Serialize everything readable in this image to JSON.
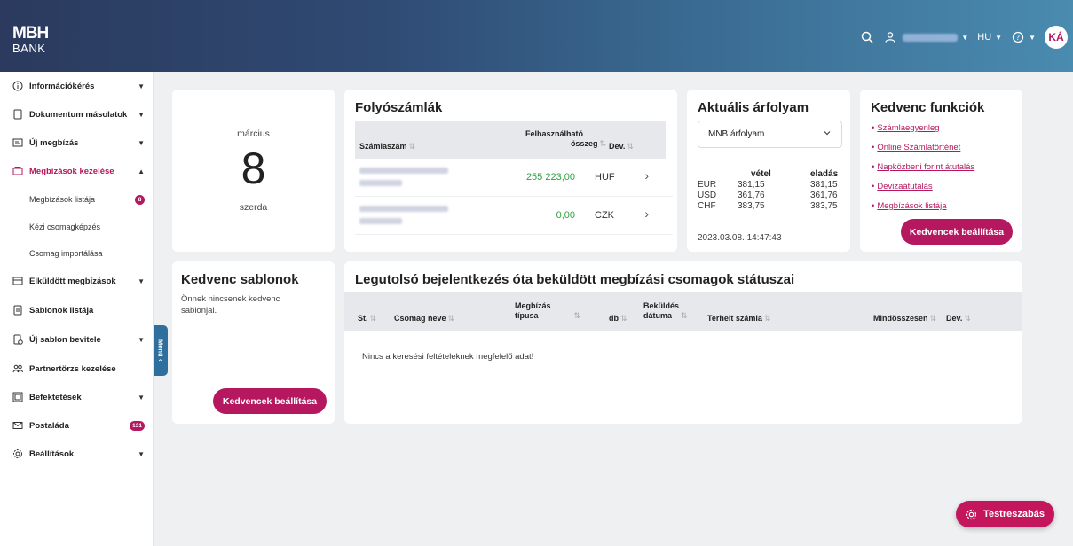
{
  "brand": {
    "logo_line1": "MBH",
    "logo_line2": "BANK"
  },
  "header": {
    "language": "HU",
    "avatar_initials": "KÁ"
  },
  "sidebar": {
    "items": [
      {
        "label": "Információkérés"
      },
      {
        "label": "Dokumentum másolatok"
      },
      {
        "label": "Új megbízás"
      },
      {
        "label": "Megbízások kezelése"
      },
      {
        "label": "Elküldött megbízások"
      },
      {
        "label": "Sablonok listája"
      },
      {
        "label": "Új sablon bevitele"
      },
      {
        "label": "Partnertörzs kezelése"
      },
      {
        "label": "Befektetések"
      },
      {
        "label": "Postaláda",
        "badge": "131"
      },
      {
        "label": "Beállítások"
      }
    ],
    "subitems": [
      {
        "label": "Megbízások listája",
        "badge": "8"
      },
      {
        "label": "Kézi csomagképzés"
      },
      {
        "label": "Csomag importálása"
      }
    ],
    "menu_tab": "Menü"
  },
  "date_card": {
    "month": "március",
    "day": "8",
    "weekday": "szerda"
  },
  "accounts": {
    "title": "Folyószámlák",
    "col_account": "Számlaszám",
    "col_available_1": "Felhasználható",
    "col_available_2": "összeg",
    "col_currency": "Dev.",
    "rows": [
      {
        "amount": "255 223,00",
        "currency": "HUF"
      },
      {
        "amount": "0,00",
        "currency": "CZK"
      }
    ]
  },
  "rates": {
    "title": "Aktuális árfolyam",
    "select": "MNB árfolyam",
    "col_buy": "vétel",
    "col_sell": "eladás",
    "rows": [
      {
        "cur": "EUR",
        "buy": "381,15",
        "sell": "381,15"
      },
      {
        "cur": "USD",
        "buy": "361,76",
        "sell": "361,76"
      },
      {
        "cur": "CHF",
        "buy": "383,75",
        "sell": "383,75"
      }
    ],
    "timestamp": "2023.03.08. 14:47:43"
  },
  "favorites": {
    "title": "Kedvenc funkciók",
    "links": [
      "Számlaegyenleg",
      "Online Számlatörténet",
      "Napközbeni forint átutalás",
      "Devizaátutalás",
      "Megbízások listája"
    ],
    "button": "Kedvencek beállítása"
  },
  "templates": {
    "title": "Kedvenc sablonok",
    "empty_text": "Önnek nincsenek kedvenc sablonjai.",
    "button": "Kedvencek beállítása"
  },
  "packages": {
    "title": "Legutolsó bejelentkezés óta beküldött megbízási csomagok státuszai",
    "cols": {
      "status": "St.",
      "name": "Csomag neve",
      "type_1": "Megbízás",
      "type_2": "típusa",
      "count": "db",
      "date_1": "Beküldés",
      "date_2": "dátuma",
      "account": "Terhelt számla",
      "total": "Mindösszesen",
      "currency": "Dev."
    },
    "empty_text": "Nincs a keresési feltételeknek megfelelő adat!"
  },
  "fab": {
    "label": "Testreszabás"
  },
  "colors": {
    "accent": "#b5185f",
    "header_start": "#2b3a5e",
    "header_end": "#4a8bb0",
    "positive": "#2ea043"
  }
}
